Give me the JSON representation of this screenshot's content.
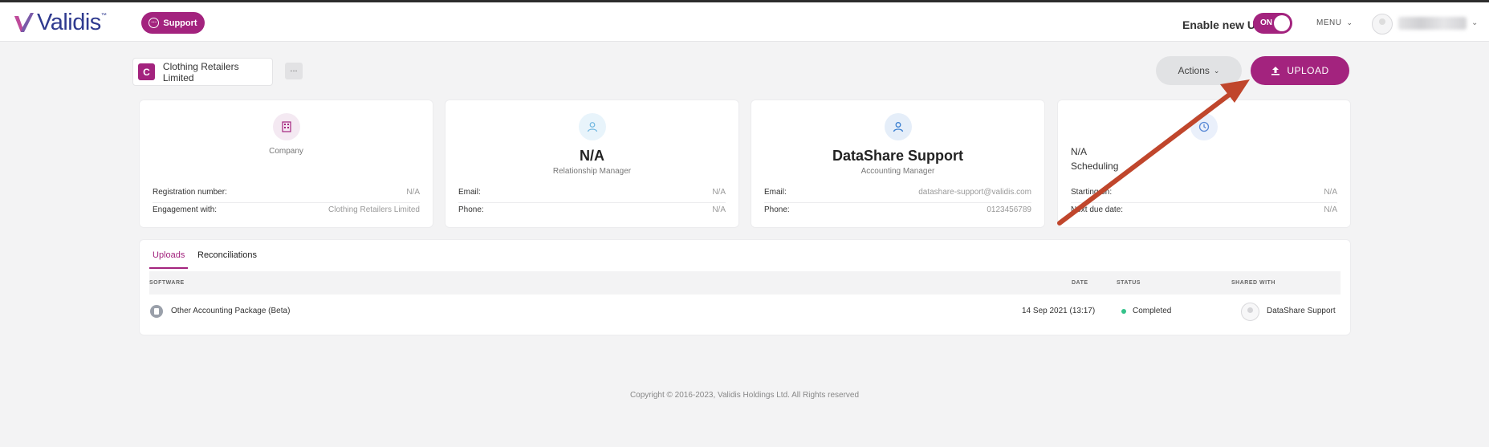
{
  "header": {
    "logo_text": "Validis",
    "logo_tm": "™",
    "support_label": "Support",
    "enable_label": "Enable new UI",
    "toggle_label": "ON",
    "menu_label": "MENU"
  },
  "company": {
    "initial": "C",
    "name": "Clothing Retailers Limited",
    "more_label": "...",
    "actions_label": "Actions",
    "upload_label": "UPLOAD"
  },
  "cards": {
    "company": {
      "caption": "Company",
      "rows": [
        {
          "label": "Registration number:",
          "value": "N/A"
        },
        {
          "label": "Engagement with:",
          "value": "Clothing Retailers Limited"
        }
      ]
    },
    "relationship": {
      "title": "N/A",
      "caption": "Relationship Manager",
      "rows": [
        {
          "label": "Email:",
          "value": "N/A"
        },
        {
          "label": "Phone:",
          "value": "N/A"
        }
      ]
    },
    "accounting": {
      "title": "DataShare Support",
      "caption": "Accounting Manager",
      "rows": [
        {
          "label": "Email:",
          "value": "datashare-support@validis.com"
        },
        {
          "label": "Phone:",
          "value": "0123456789"
        }
      ]
    },
    "scheduling": {
      "title": "N/A",
      "caption": "Scheduling",
      "rows": [
        {
          "label": "Starting on:",
          "value": "N/A"
        },
        {
          "label": "Next due date:",
          "value": "N/A"
        }
      ]
    }
  },
  "tabs": [
    {
      "label": "Uploads",
      "active": true
    },
    {
      "label": "Reconciliations",
      "active": false
    }
  ],
  "table": {
    "headers": {
      "software": "SOFTWARE",
      "date": "DATE",
      "status": "STATUS",
      "shared": "SHARED WITH"
    },
    "rows": [
      {
        "software": "Other Accounting Package (Beta)",
        "date": "14 Sep 2021 (13:17)",
        "status": "Completed",
        "shared": "DataShare Support"
      }
    ]
  },
  "footer": "Copyright © 2016-2023, Validis Holdings Ltd. All Rights reserved",
  "colors": {
    "brand": "#a3237e",
    "logo": "#2f3a8f",
    "status_ok": "#34c28a",
    "arrow": "#c0462c"
  }
}
